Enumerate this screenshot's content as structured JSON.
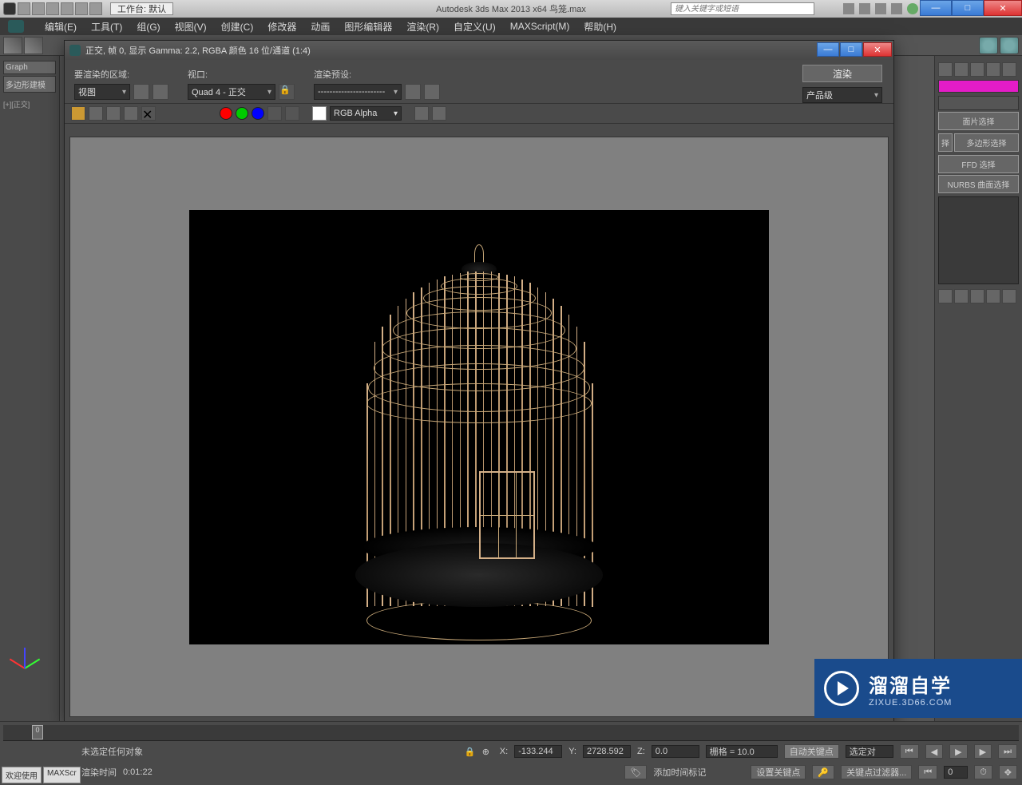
{
  "titlebar": {
    "workspace_label": "工作台: 默认",
    "app_title": "Autodesk 3ds Max  2013 x64    鸟笼.max",
    "search_placeholder": "键入关键字或短语"
  },
  "menubar": {
    "items": [
      "编辑(E)",
      "工具(T)",
      "组(G)",
      "视图(V)",
      "创建(C)",
      "修改器",
      "动画",
      "图形编辑器",
      "渲染(R)",
      "自定义(U)",
      "MAXScript(M)",
      "帮助(H)"
    ]
  },
  "left_panel": {
    "l1": "Graph",
    "l2": "多边形建模",
    "l3": "[+][正交]"
  },
  "right_panel": {
    "btns": [
      "面片选择",
      "多边形选择",
      "FFD 选择",
      "NURBS 曲面选择"
    ],
    "partial": "择"
  },
  "render_window": {
    "title": "正交, 帧 0, 显示 Gamma: 2.2, RGBA 颜色 16 位/通道 (1:4)",
    "region_label": "要渲染的区域:",
    "region_value": "视图",
    "viewport_label": "视口:",
    "viewport_value": "Quad 4 - 正交",
    "preset_label": "渲染预设:",
    "preset_value": "-----------------------",
    "render_btn": "渲染",
    "product_value": "产品级",
    "alpha_value": "RGB Alpha"
  },
  "status": {
    "timeline_mark": "0",
    "msg": "未选定任何对象",
    "x_label": "X:",
    "x_value": "-133.244",
    "y_label": "Y:",
    "y_value": "2728.592",
    "z_label": "Z:",
    "z_value": "0.0",
    "grid": "栅格 = 10.0",
    "autokey": "自动关键点",
    "selkey": "选定对",
    "setkey": "设置关键点",
    "keyfilter": "关键点过滤器...",
    "render_time_label": "渲染时间",
    "render_time_value": "0:01:22",
    "addmarker": "添加时间标记",
    "tab1": "欢迎使用",
    "tab2": "MAXScr"
  },
  "watermark": {
    "t1": "溜溜自学",
    "t2": "ZIXUE.3D66.COM"
  }
}
